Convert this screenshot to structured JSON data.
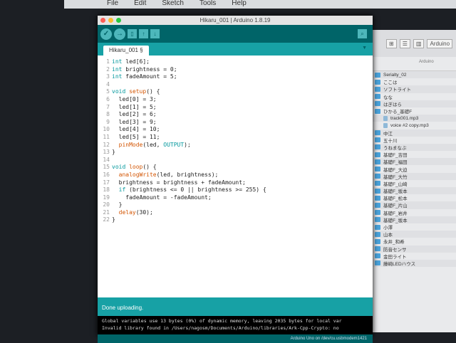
{
  "menubar": [
    "File",
    "Edit",
    "Sketch",
    "Tools",
    "Help"
  ],
  "window": {
    "title": "Hikaru_001 | Arduino 1.8.19",
    "tab": "Hikaru_001 §",
    "status": "Done uploading.",
    "console": [
      "Global variables use 13 bytes (0%) of dynamic memory, leaving 2035 bytes for local var",
      "Invalid library found in /Users/nagosm/Documents/Arduino/libraries/Ark-Cpp-Crypto: no"
    ],
    "board": "Arduino Uno on /dev/cu.usbmodem1421"
  },
  "code": [
    "int led[6];",
    "int brightness = 0;",
    "int fadeAmount = 5;",
    "",
    "void setup() {",
    "  led[0] = 3;",
    "  led[1] = 5;",
    "  led[2] = 6;",
    "  led[3] = 9;",
    "  led[4] = 10;",
    "  led[5] = 11;",
    "  pinMode(led, OUTPUT);",
    "}",
    "",
    "void loop() {",
    "  analogWrite(led, brightness);",
    "  brightness = brightness + fadeAmount;",
    "  if (brightness <= 0 || brightness >= 255) {",
    "    fadeAmount = -fadeAmount;",
    "  }",
    "  delay(30);",
    "}"
  ],
  "finder": {
    "title": "Arduino",
    "column": "Arduino",
    "items": [
      {
        "n": "Serialty_02",
        "t": "d"
      },
      {
        "n": "ここは",
        "t": "d"
      },
      {
        "n": "ソフトライト",
        "t": "d"
      },
      {
        "n": "なな",
        "t": "d"
      },
      {
        "n": "はぎはら",
        "t": "d"
      },
      {
        "n": "ひかる_基礎F",
        "t": "d"
      },
      {
        "n": "track001.mp3",
        "t": "f"
      },
      {
        "n": "voice #2 copy.mp3",
        "t": "f"
      },
      {
        "n": "中江",
        "t": "d"
      },
      {
        "n": "五十川",
        "t": "d"
      },
      {
        "n": "うねまなぶ",
        "t": "d"
      },
      {
        "n": "基礎F_吉田",
        "t": "d"
      },
      {
        "n": "基礎F_福田",
        "t": "d"
      },
      {
        "n": "基礎F_大迫",
        "t": "d"
      },
      {
        "n": "基礎F_大竹",
        "t": "d"
      },
      {
        "n": "基礎F_山崎",
        "t": "d"
      },
      {
        "n": "基礎F_坂本",
        "t": "d"
      },
      {
        "n": "基礎F_松本",
        "t": "d"
      },
      {
        "n": "基礎F_片山",
        "t": "d"
      },
      {
        "n": "基礎F_岩井",
        "t": "d"
      },
      {
        "n": "基礎F_坂本",
        "t": "d"
      },
      {
        "n": "小澤",
        "t": "d"
      },
      {
        "n": "山本",
        "t": "d"
      },
      {
        "n": "永井_和希",
        "t": "d"
      },
      {
        "n": "防音センサ",
        "t": "d"
      },
      {
        "n": "金田ライト",
        "t": "d"
      },
      {
        "n": "藤崎LEDハウス",
        "t": "d"
      }
    ]
  }
}
